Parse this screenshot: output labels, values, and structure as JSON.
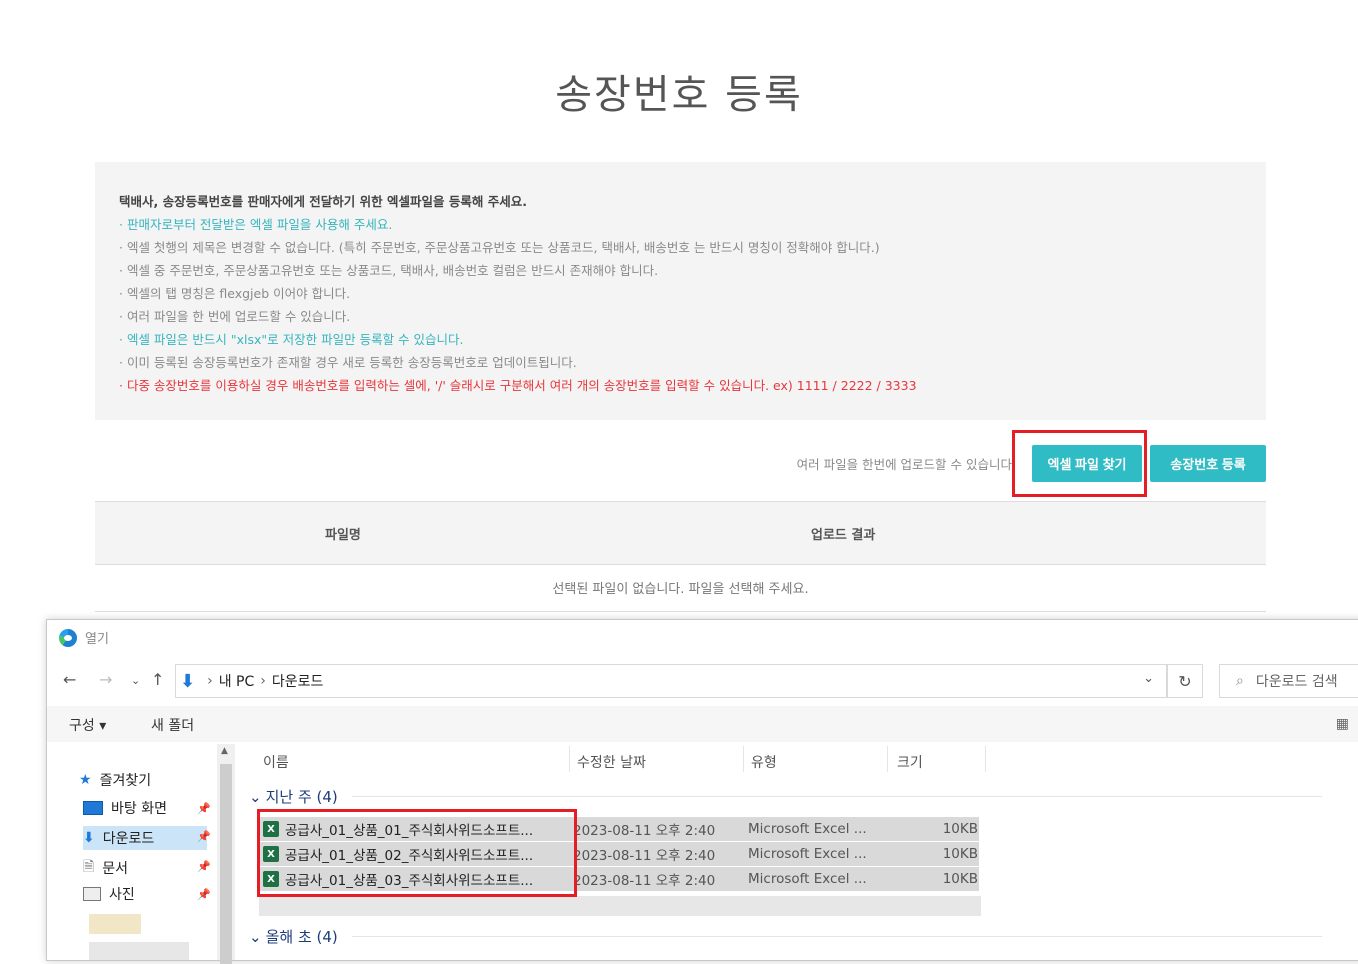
{
  "page": {
    "title": "송장번호 등록"
  },
  "notice": {
    "lines": [
      "택배사, 송장등록번호를 판매자에게 전달하기 위한 엑셀파일을 등록해 주세요.",
      "· 판매자로부터 전달받은 엑셀 파일을 사용해 주세요.",
      "· 엑셀 첫행의 제목은 변경할 수 없습니다. (특히 주문번호, 주문상품고유번호 또는 상품코드, 택배사, 배송번호 는 반드시 명칭이 정확해야 합니다.)",
      "· 엑셀 중 주문번호, 주문상품고유번호 또는 상품코드, 택배사, 배송번호 컬럼은 반드시 존재해야 합니다.",
      "· 엑셀의 탭 명칭은 flexgjeb 이어야 합니다.",
      "· 여러 파일을 한 번에 업로드할 수 있습니다.",
      "· 엑셀 파일은 반드시 \"xlsx\"로 저장한 파일만 등록할 수 있습니다.",
      "· 이미 등록된 송장등록번호가 존재할 경우 새로 등록한 송장등록번호로 업데이트됩니다.",
      "· 다중 송장번호를 이용하실 경우 배송번호를 입력하는 셀에, '/' 슬래시로 구분해서 여러 개의 송장번호를 입력할 수 있습니다. ex) 1111 / 2222 / 3333"
    ]
  },
  "upload": {
    "hint": "여러 파일을 한번에 업로드할 수 있습니다",
    "find_button": "엑셀 파일 찾기",
    "register_button": "송장번호 등록"
  },
  "table": {
    "headers": [
      "파일명",
      "업로드 결과"
    ],
    "empty_message": "선택된 파일이 없습니다. 파일을 선택해 주세요."
  },
  "dialog": {
    "title": "열기",
    "breadcrumb": [
      "내 PC",
      "다운로드"
    ],
    "search_placeholder": "다운로드 검색",
    "toolbar": {
      "organize": "구성 ▾",
      "new_folder": "새 폴더"
    },
    "nav": {
      "favorites": "즐겨찾기",
      "items": [
        "바탕 화면",
        "다운로드",
        "문서",
        "사진"
      ]
    },
    "columns": [
      "이름",
      "수정한 날짜",
      "유형",
      "크기"
    ],
    "groups": {
      "last_week": "지난 주 (4)",
      "this_year": "올해 초 (4)"
    },
    "files": [
      {
        "name": "공급사_01_상품_01_주식회사위드소프트...",
        "date": "2023-08-11 오후 2:40",
        "type": "Microsoft Excel ...",
        "size": "10KB"
      },
      {
        "name": "공급사_01_상품_02_주식회사위드소프트...",
        "date": "2023-08-11 오후 2:40",
        "type": "Microsoft Excel ...",
        "size": "10KB"
      },
      {
        "name": "공급사_01_상품_03_주식회사위드소프트...",
        "date": "2023-08-11 오후 2:40",
        "type": "Microsoft Excel ...",
        "size": "10KB"
      }
    ]
  },
  "colors": {
    "accent": "#2fbcc4",
    "highlight_box": "#e51e25",
    "teal_text": "#36b5bd",
    "red_text": "#e8363b"
  }
}
